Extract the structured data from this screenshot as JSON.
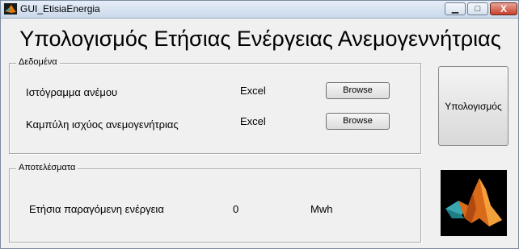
{
  "window": {
    "title": "GUI_EtisiaEnergia",
    "controls": {
      "minimize": "▁",
      "maximize": "□",
      "close": "X"
    }
  },
  "heading": "Υπολογισμός Ετήσιας Ενέργειας Ανεμογεννήτριας",
  "data_panel": {
    "title": "Δεδομένα",
    "rows": [
      {
        "label": "Ιστόγραμμα ανέμου",
        "source": "Excel",
        "button": "Browse"
      },
      {
        "label": "Καμπύλη ισχύος ανεμογενήτριας",
        "source": "Excel",
        "button": "Browse"
      }
    ]
  },
  "calculate_button": "Υπολογισμός",
  "results_panel": {
    "title": "Αποτελέσματα",
    "label": "Ετήσια παραγόμενη ενέργεια",
    "value": "0",
    "unit": "Mwh"
  },
  "icons": {
    "app": "matlab-icon",
    "logo": "matlab-logo"
  }
}
